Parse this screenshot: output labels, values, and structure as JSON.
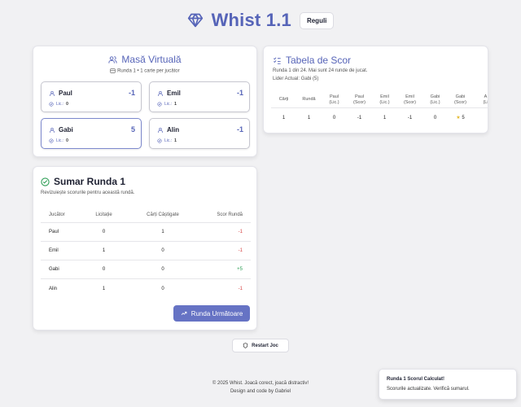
{
  "app": {
    "title": "Whist 1.1",
    "rules_label": "Reguli"
  },
  "table": {
    "title": "Masă Virtuală",
    "subtitle": "Runda 1 • 1 carte per jucător",
    "bid_prefix": "Lic.:",
    "players": [
      {
        "name": "Paul",
        "score": "-1",
        "bid": "0"
      },
      {
        "name": "Emil",
        "score": "-1",
        "bid": "1"
      },
      {
        "name": "Gabi",
        "score": "5",
        "bid": "0"
      },
      {
        "name": "Alin",
        "score": "-1",
        "bid": "1"
      }
    ]
  },
  "scoreboard": {
    "title": "Tabela de Scor",
    "round_info": "Runda 1 din 24. Mai sunt 24 runde de jucat.",
    "leader": "Lider Actual: Gabi (5)",
    "headers": [
      [
        "Cărți",
        ""
      ],
      [
        "Rundă",
        ""
      ],
      [
        "Paul",
        "(Lic.)"
      ],
      [
        "Paul",
        "(Scor)"
      ],
      [
        "Emil",
        "(Lic.)"
      ],
      [
        "Emil",
        "(Scor)"
      ],
      [
        "Gabi",
        "(Lic.)"
      ],
      [
        "Gabi",
        "(Scor)"
      ],
      [
        "A",
        "(Li"
      ]
    ],
    "row": [
      "1",
      "1",
      "0",
      "-1",
      "1",
      "-1",
      "0",
      "5",
      ""
    ],
    "star": "★"
  },
  "summary": {
    "title": "Sumar Runda 1",
    "subtitle": "Revizuiește scorurile pentru această rundă.",
    "headers": [
      "Jucător",
      "Licitație",
      "Cărți Câștigate",
      "Scor Rundă"
    ],
    "rows": [
      {
        "player": "Paul",
        "bid": "0",
        "won": "1",
        "score": "-1"
      },
      {
        "player": "Emil",
        "bid": "1",
        "won": "0",
        "score": "-1"
      },
      {
        "player": "Gabi",
        "bid": "0",
        "won": "0",
        "score": "+5"
      },
      {
        "player": "Alin",
        "bid": "1",
        "won": "0",
        "score": "-1"
      }
    ],
    "next_label": "Runda Următoare"
  },
  "restart_label": "Restart Joc",
  "footer": {
    "line1": "© 2025 Whist. Joacă corect, joacă distractiv!",
    "line2": "Design and code by Gabriel"
  },
  "toast": {
    "title": "Runda 1 Scorul Calculat!",
    "message": "Scorurile actualizate. Verifică sumarul."
  },
  "colors": {
    "accent": "#5664b8",
    "button": "#6673c4",
    "negative": "#d64545",
    "positive": "#2e9e56",
    "star": "#e5b92b"
  },
  "icons": [
    "gem-icon",
    "users-icon",
    "user-icon",
    "badge-check-icon",
    "list-checks-icon",
    "check-circle-icon",
    "trend-up-icon",
    "shield-icon",
    "card-icon"
  ]
}
